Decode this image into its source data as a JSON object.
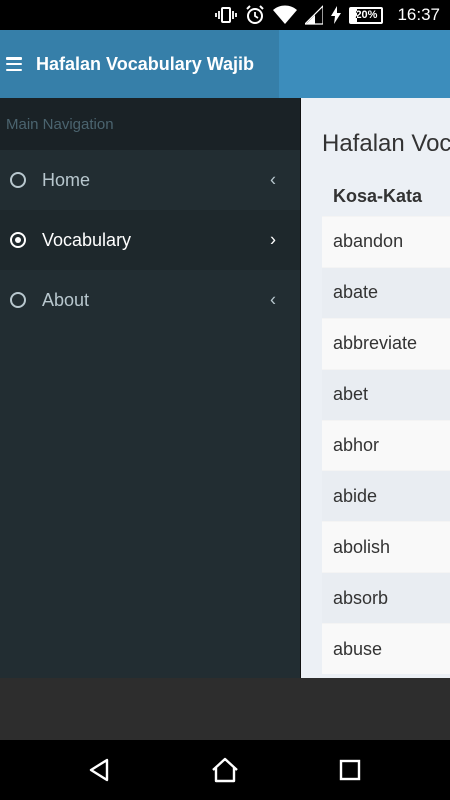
{
  "status": {
    "time": "16:37",
    "battery": "20%",
    "battery_level": 0.2
  },
  "header": {
    "title": "Hafalan Vocabulary Wajib",
    "menu_icon": "hamburger-icon",
    "color": "#3c8dbc"
  },
  "sidebar": {
    "section_label": "Main Navigation",
    "items": [
      {
        "label": "Home",
        "icon": "radio-unchecked-icon",
        "chevron": "‹"
      },
      {
        "label": "Vocabulary",
        "icon": "radio-checked-icon",
        "chevron": "›"
      },
      {
        "label": "About",
        "icon": "radio-unchecked-icon",
        "chevron": "‹"
      }
    ]
  },
  "main": {
    "title": "Hafalan Vocabulary Wajib",
    "table": {
      "header": "Kosa-Kata",
      "rows": [
        "abandon",
        "abate",
        "abbreviate",
        "abet",
        "abhor",
        "abide",
        "abolish",
        "absorb",
        "abuse"
      ]
    }
  },
  "system_nav": {
    "back_icon": "back-triangle-icon",
    "home_icon": "home-icon",
    "recents_icon": "recents-square-icon"
  }
}
